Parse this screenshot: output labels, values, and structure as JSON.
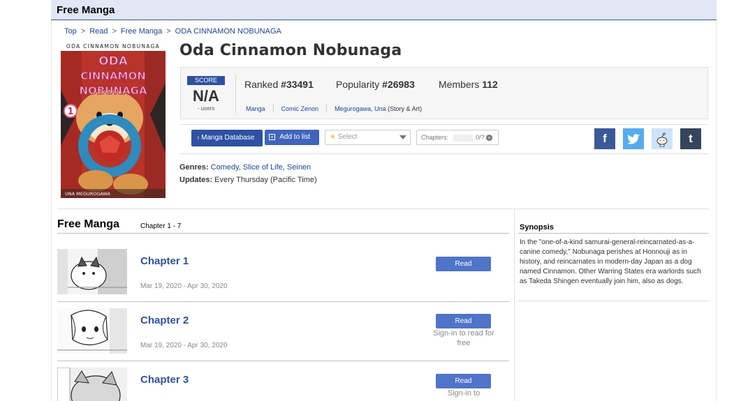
{
  "header": {
    "title": "Free Manga"
  },
  "breadcrumb": [
    "Top",
    "Read",
    "Free Manga",
    "ODA CINNAMON NOBUNAGA"
  ],
  "manga": {
    "title": "Oda Cinnamon Nobunaga"
  },
  "cover": {
    "top_text": "ODA CINNAMON NOBUNAGA",
    "logo_line1": "ODA",
    "logo_line2": "CINNAMON",
    "logo_line3": "NOBUNAGA",
    "volume": "1",
    "author_text": "UNA MEGUROGAWA"
  },
  "stats": {
    "score_label": "SCORE",
    "score_value": "N/A",
    "score_users": "- users",
    "ranked_label": "Ranked",
    "ranked_value": "#33491",
    "popularity_label": "Popularity",
    "popularity_value": "#26983",
    "members_label": "Members",
    "members_value": "112",
    "type": "Manga",
    "magazine": "Comic Zenon",
    "author": "Megurogawa, Una",
    "author_role": "(Story & Art)"
  },
  "actions": {
    "database_label": "Manga Database",
    "add_label": "Add to list",
    "select_placeholder": "Select",
    "chapters_label": "Chapters:",
    "chapters_value": "0/?"
  },
  "social": {
    "facebook": "f",
    "twitter": "t",
    "tumblr": "t"
  },
  "info": {
    "genres_label": "Genres:",
    "genres": [
      "Comedy",
      "Slice of Life",
      "Seinen"
    ],
    "updates_label": "Updates:",
    "updates_value": "Every Thursday (Pacific Time)"
  },
  "section": {
    "title": "Free Manga",
    "subtitle": "Chapter 1 - 7"
  },
  "chapters": [
    {
      "title": "Chapter 1",
      "date": "Mar 19, 2020 - Apr 30, 2020",
      "read": "Read"
    },
    {
      "title": "Chapter 2",
      "date": "Mar 19, 2020 - Apr 30, 2020",
      "read": "Read",
      "signin": "Sign-in to read for free"
    },
    {
      "title": "Chapter 3",
      "date": "",
      "read": "Read",
      "signin": "Sign-in to"
    }
  ],
  "synopsis": {
    "title": "Synopsis",
    "text": "In the \"one-of-a-kind samurai-general-reincarnated-as-a-canine comedy,\" Nobunaga perishes at Honnouji as in history, and reincarnates in modern-day Japan as a dog named Cinnamon. Other Warring States era warlords such as Takeda Shingen eventually join him, also as dogs."
  },
  "colors": {
    "accent": "#2e51a2",
    "header_bg": "#e1e7f5",
    "link": "#1c439b",
    "facebook": "#3b5998",
    "twitter": "#55acee",
    "reddit": "#cee3f8",
    "tumblr": "#35465c"
  }
}
